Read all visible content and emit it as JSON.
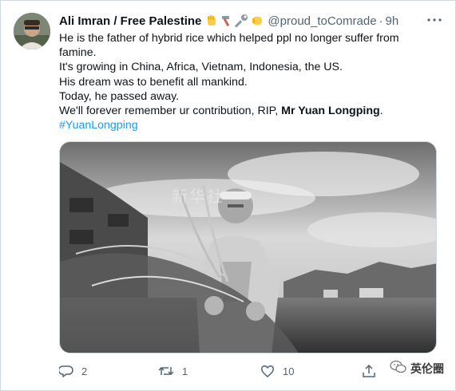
{
  "tweet": {
    "author_name": "Ali Imran / Free Palestine",
    "author_handle": "@proud_toComrade",
    "separator": "·",
    "timestamp": "9h",
    "emojis": [
      "raised-fist-icon",
      "hammer-icon",
      "wrench-icon",
      "fist-bump-icon"
    ],
    "text_lines": [
      "He is the father of hybrid rice which helped ppl no longer suffer from",
      "famine.",
      "It's growing in China, Africa, Vietnam, Indonesia,  the US.",
      "His dream was to benefit all mankind.",
      "Today, he passed away."
    ],
    "last_line_prefix": "We'll forever remember ur contribution, RIP, ",
    "last_line_bold": "Mr Yuan Longping",
    "last_line_suffix": ".",
    "hashtag": "#YuanLongping",
    "image_watermark": "新华社",
    "actions": {
      "reply_count": "2",
      "retweet_count": "1",
      "like_count": "10"
    }
  },
  "watermark_brand": "英伦圈",
  "colors": {
    "accent": "#1d9bf0",
    "text_primary": "#0f1419",
    "text_secondary": "#536471",
    "border": "#cfd9de"
  }
}
